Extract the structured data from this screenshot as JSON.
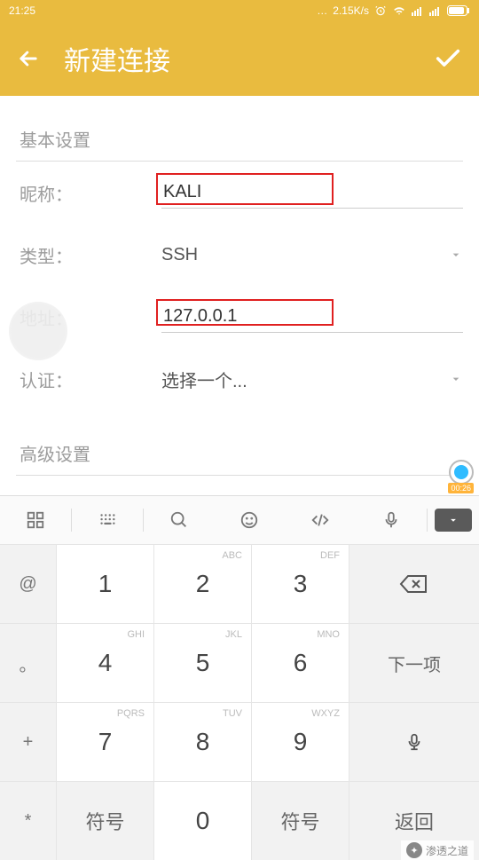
{
  "status": {
    "time": "21:25",
    "speed": "2.15K/s"
  },
  "header": {
    "title": "新建连接"
  },
  "sections": {
    "basic": "基本设置",
    "advanced": "高级设置"
  },
  "fields": {
    "nickname": {
      "label": "昵称：",
      "value": "KALI"
    },
    "type": {
      "label": "类型：",
      "value": "SSH"
    },
    "address": {
      "label": "地址：",
      "value": "127.0.0.1"
    },
    "auth": {
      "label": "认证：",
      "value": "选择一个..."
    }
  },
  "recording": {
    "time": "00:26"
  },
  "keyboard": {
    "side": [
      "@",
      "。",
      "+",
      "*"
    ],
    "nums": [
      [
        "1",
        "2",
        "3"
      ],
      [
        "4",
        "5",
        "6"
      ],
      [
        "7",
        "8",
        "9"
      ],
      [
        "",
        "0",
        ""
      ]
    ],
    "sups": [
      [
        "",
        "ABC",
        "DEF"
      ],
      [
        "GHI",
        "JKL",
        "MNO"
      ],
      [
        "PQRS",
        "TUV",
        "WXYZ"
      ],
      [
        "",
        "",
        ""
      ]
    ],
    "actions": {
      "next": "下一项",
      "symbol": "符号",
      "return": "返回"
    }
  },
  "watermark": "渗透之道"
}
